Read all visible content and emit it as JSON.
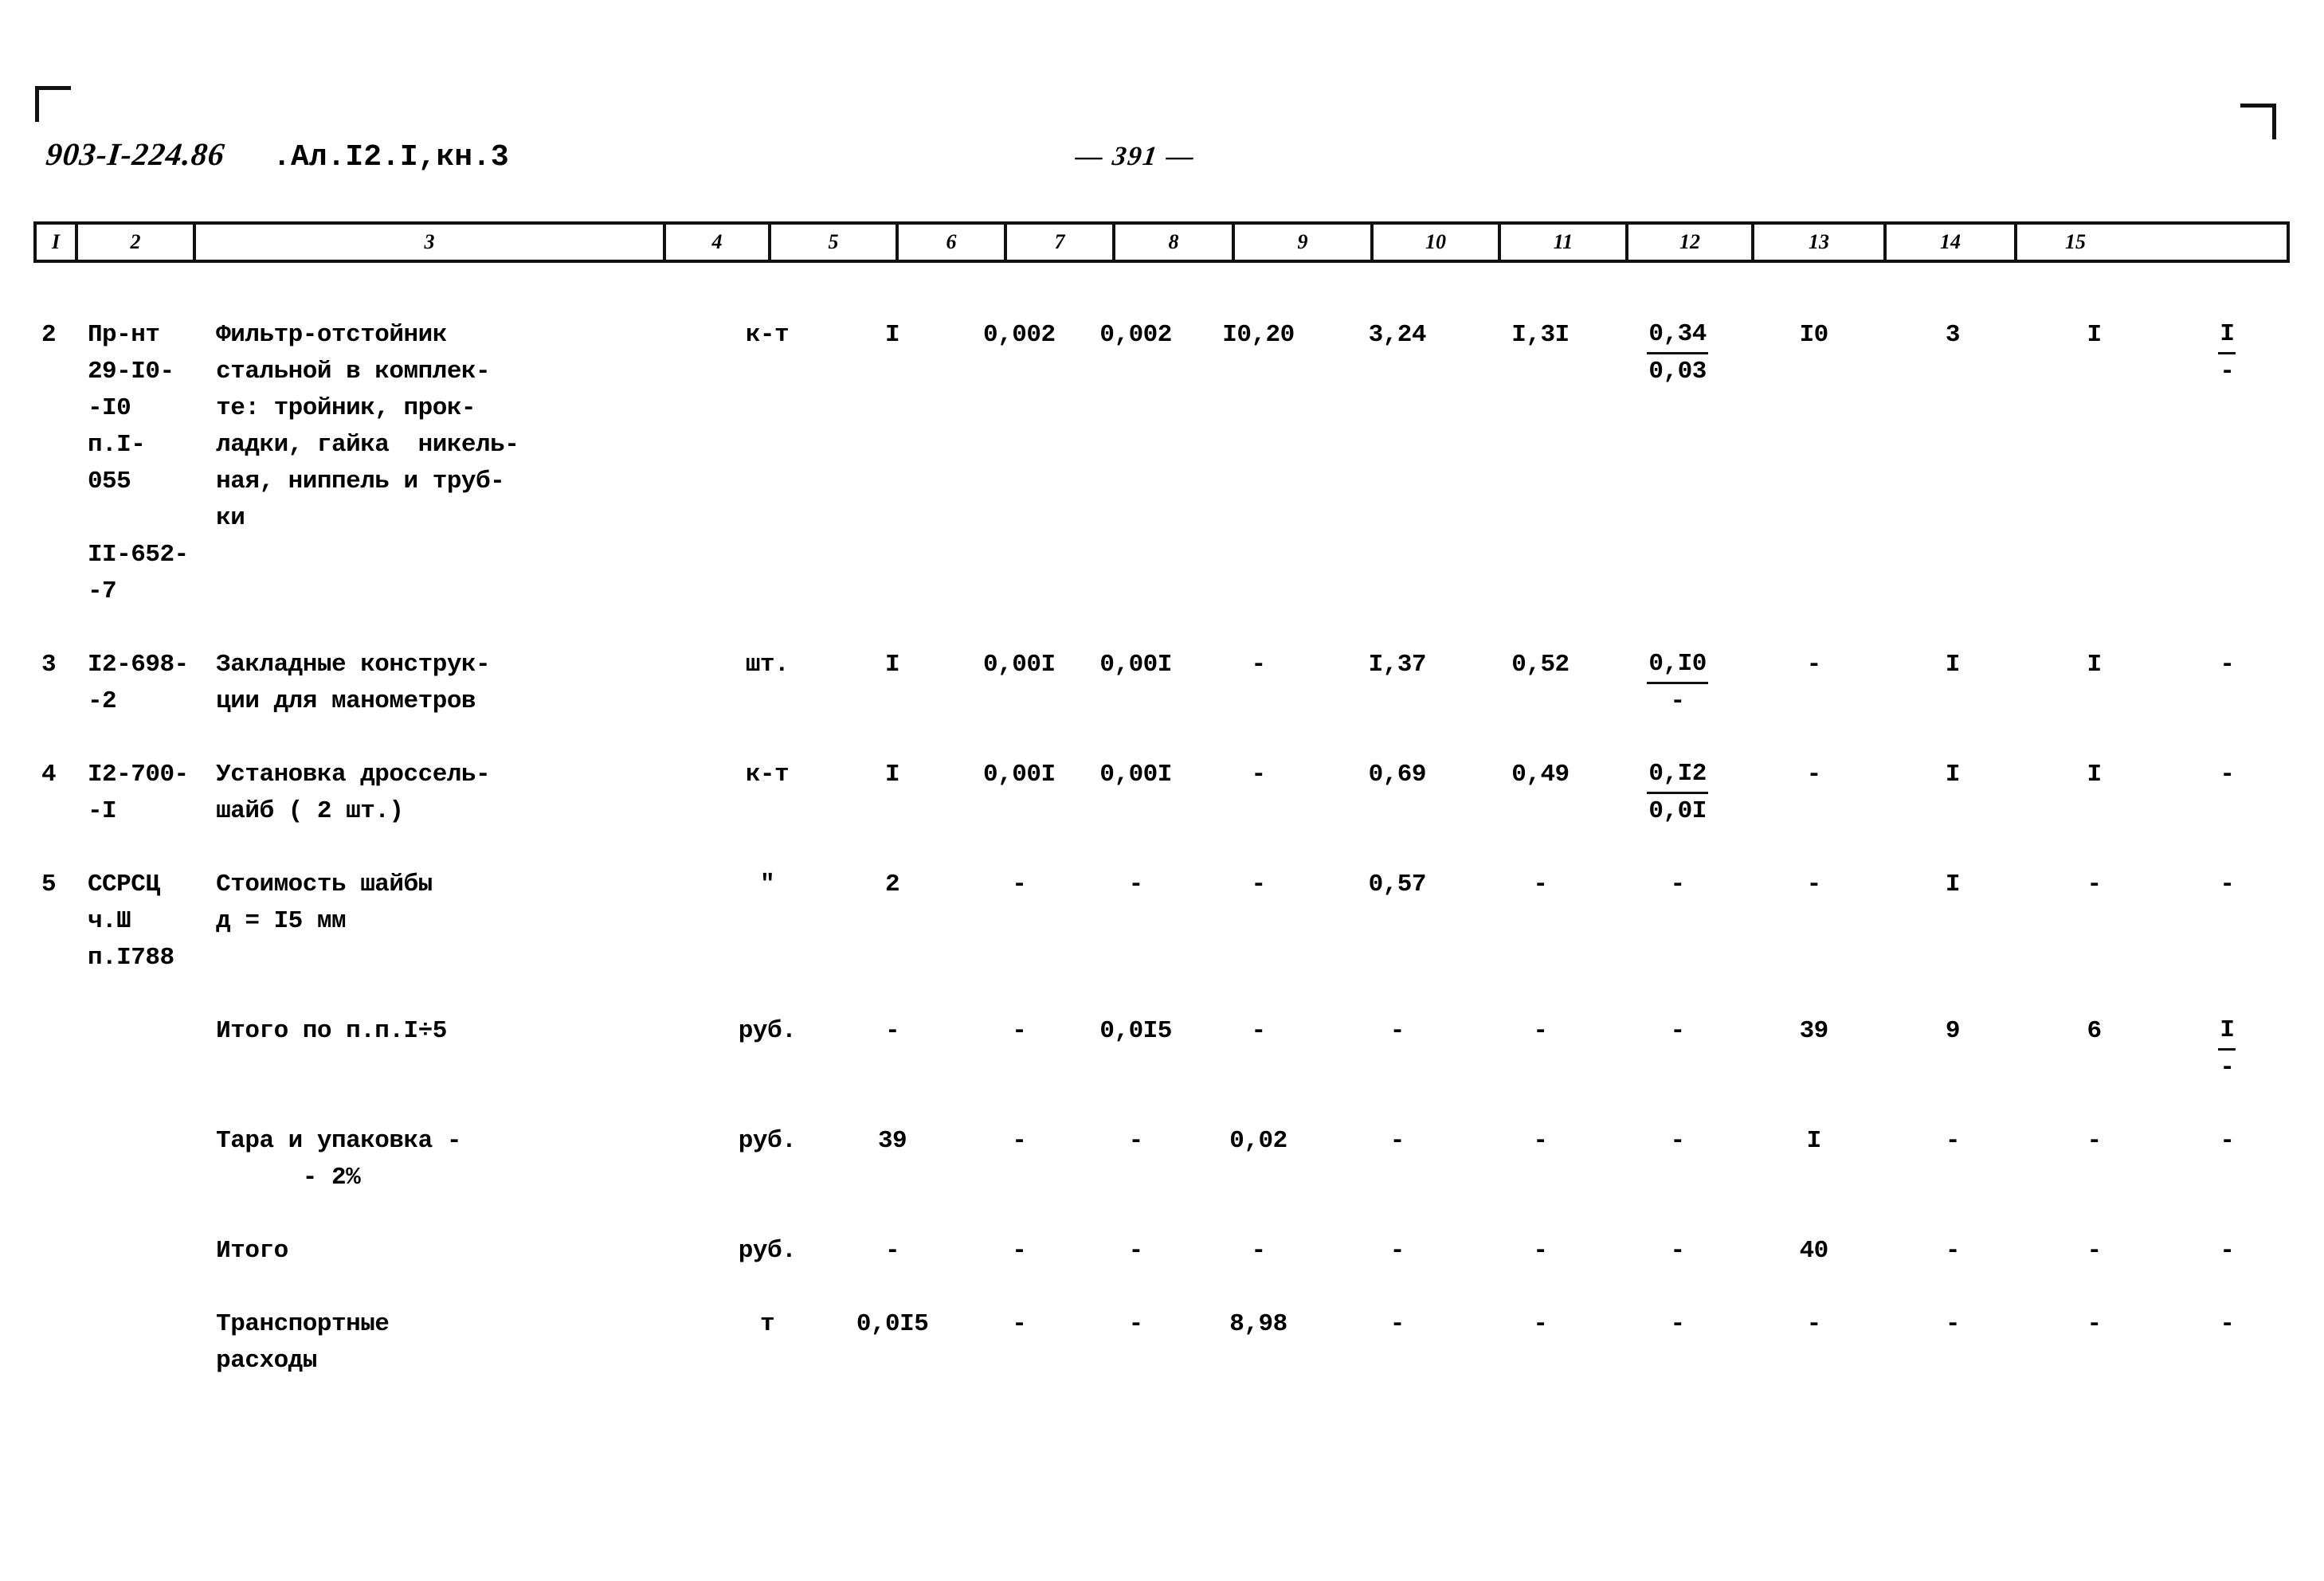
{
  "header": {
    "doc_code": "903-I-224.86",
    "album": ".Ал.I2.I,кн.3",
    "page_number": "— 391 —"
  },
  "table": {
    "column_numbers": [
      "I",
      "2",
      "3",
      "4",
      "5",
      "6",
      "7",
      "8",
      "9",
      "10",
      "11",
      "12",
      "13",
      "14",
      "15"
    ],
    "rows": [
      {
        "num": "2",
        "code": "Пр-нт\n29-I0-\n-I0\nп.I-\n055\n\nII-652-\n-7",
        "desc": "Фильтр-отстойник\nстальной в комплек-\nте: тройник, прок-\nладки, гайка  никель-\nная, ниппель и труб-\nки",
        "unit": "к-т",
        "c5": "I",
        "c6": "0,002",
        "c7": "0,002",
        "c8": "I0,20",
        "c9": "3,24",
        "c10": "I,3I",
        "c11_top": "0,34",
        "c11_bot": "0,03",
        "c12": "I0",
        "c13": "3",
        "c14": "I",
        "c15_top": "I",
        "c15_bot": "-"
      },
      {
        "num": "3",
        "code": "I2-698-\n-2",
        "desc": "Закладные конструк-\nции для манометров",
        "unit": "шт.",
        "c5": "I",
        "c6": "0,00I",
        "c7": "0,00I",
        "c8": "-",
        "c9": "I,37",
        "c10": "0,52",
        "c11_top": "0,I0",
        "c11_bot": "-",
        "c12": "-",
        "c13": "I",
        "c14": "I",
        "c15_top": "-",
        "c15_bot": ""
      },
      {
        "num": "4",
        "code": "I2-700-\n-I",
        "desc": "Установка дроссель-\nшайб ( 2 шт.)",
        "unit": "к-т",
        "c5": "I",
        "c6": "0,00I",
        "c7": "0,00I",
        "c8": "-",
        "c9": "0,69",
        "c10": "0,49",
        "c11_top": "0,I2",
        "c11_bot": "0,0I",
        "c12": "-",
        "c13": "I",
        "c14": "I",
        "c15_top": "-",
        "c15_bot": ""
      },
      {
        "num": "5",
        "code": "ССРСЦ\nч.Ш\nп.I788",
        "desc": "Стоимость шайбы\nд = I5 мм",
        "unit": "\"",
        "c5": "2",
        "c6": "-",
        "c7": "-",
        "c8": "-",
        "c9": "0,57",
        "c10": "-",
        "c11_top": "-",
        "c11_bot": "",
        "c12": "-",
        "c13": "I",
        "c14": "-",
        "c15_top": "-",
        "c15_bot": ""
      }
    ],
    "summary_rows": [
      {
        "desc": "Итого по п.п.I÷5",
        "unit": "руб.",
        "c5": "-",
        "c6": "-",
        "c7": "0,0I5",
        "c8": "-",
        "c9": "-",
        "c10": "-",
        "c11_top": "-",
        "c11_bot": "",
        "c12": "39",
        "c13": "9",
        "c14": "6",
        "c15_top": "I",
        "c15_bot": "-"
      },
      {
        "desc": "Тара и упаковка -\n      - 2%",
        "unit": "руб.",
        "c5": "39",
        "c6": "-",
        "c7": "-",
        "c8": "0,02",
        "c9": "-",
        "c10": "-",
        "c11_top": "-",
        "c11_bot": "",
        "c12": "I",
        "c13": "-",
        "c14": "-",
        "c15_top": "-",
        "c15_bot": ""
      },
      {
        "desc": "Итого",
        "unit": "руб.",
        "c5": "-",
        "c6": "-",
        "c7": "-",
        "c8": "-",
        "c9": "-",
        "c10": "-",
        "c11_top": "-",
        "c11_bot": "",
        "c12": "40",
        "c13": "-",
        "c14": "-",
        "c15_top": "-",
        "c15_bot": ""
      },
      {
        "desc": "Транспортные\nрасходы",
        "unit": "т",
        "c5": "0,0I5",
        "c6": "-",
        "c7": "-",
        "c8": "8,98",
        "c9": "-",
        "c10": "-",
        "c11_top": "-",
        "c11_bot": "",
        "c12": "-",
        "c13": "-",
        "c14": "-",
        "c15_top": "-",
        "c15_bot": ""
      }
    ]
  }
}
